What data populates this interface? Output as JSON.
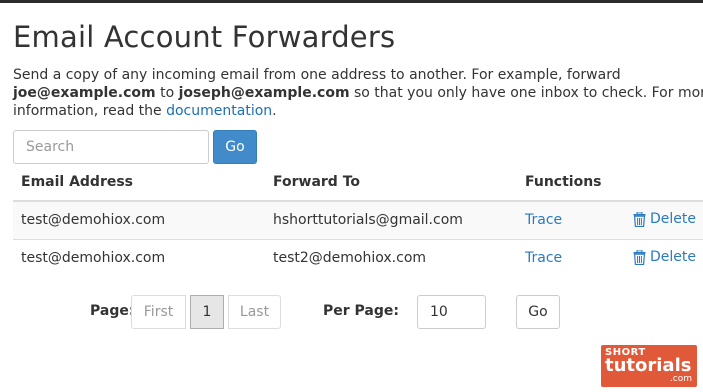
{
  "page": {
    "title": "Email Account Forwarders",
    "intro": {
      "part1": "Send a copy of any incoming email from one address to another. For example, forward ",
      "example_from": "joe@example.com",
      "part2": " to ",
      "example_to": "joseph@example.com",
      "part3": " so that you only have one inbox to check. For more information, read the ",
      "link": "documentation",
      "part4": "."
    }
  },
  "search": {
    "placeholder": "Search",
    "value": "",
    "button_label": "Go"
  },
  "table": {
    "headers": [
      "Email Address",
      "Forward To",
      "Functions"
    ],
    "rows": [
      {
        "email": "test@demohiox.com",
        "forward_to": "hshorttutorials@gmail.com",
        "trace": "Trace",
        "delete": "Delete"
      },
      {
        "email": "test@demohiox.com",
        "forward_to": "test2@demohiox.com",
        "trace": "Trace",
        "delete": "Delete"
      }
    ]
  },
  "pagination": {
    "page_label": "Page:",
    "first": "First",
    "current": "1",
    "last": "Last",
    "per_page_label": "Per Page:",
    "per_page_value": "10",
    "go_label": "Go"
  },
  "watermark": {
    "line1": "SHORT",
    "line2": "tutorials",
    "line3": ".com"
  },
  "colors": {
    "primary": "#428bca",
    "link": "#2a7ac0",
    "watermark_bg": "#e05a3a"
  },
  "icons": {
    "delete": "trash-icon"
  }
}
